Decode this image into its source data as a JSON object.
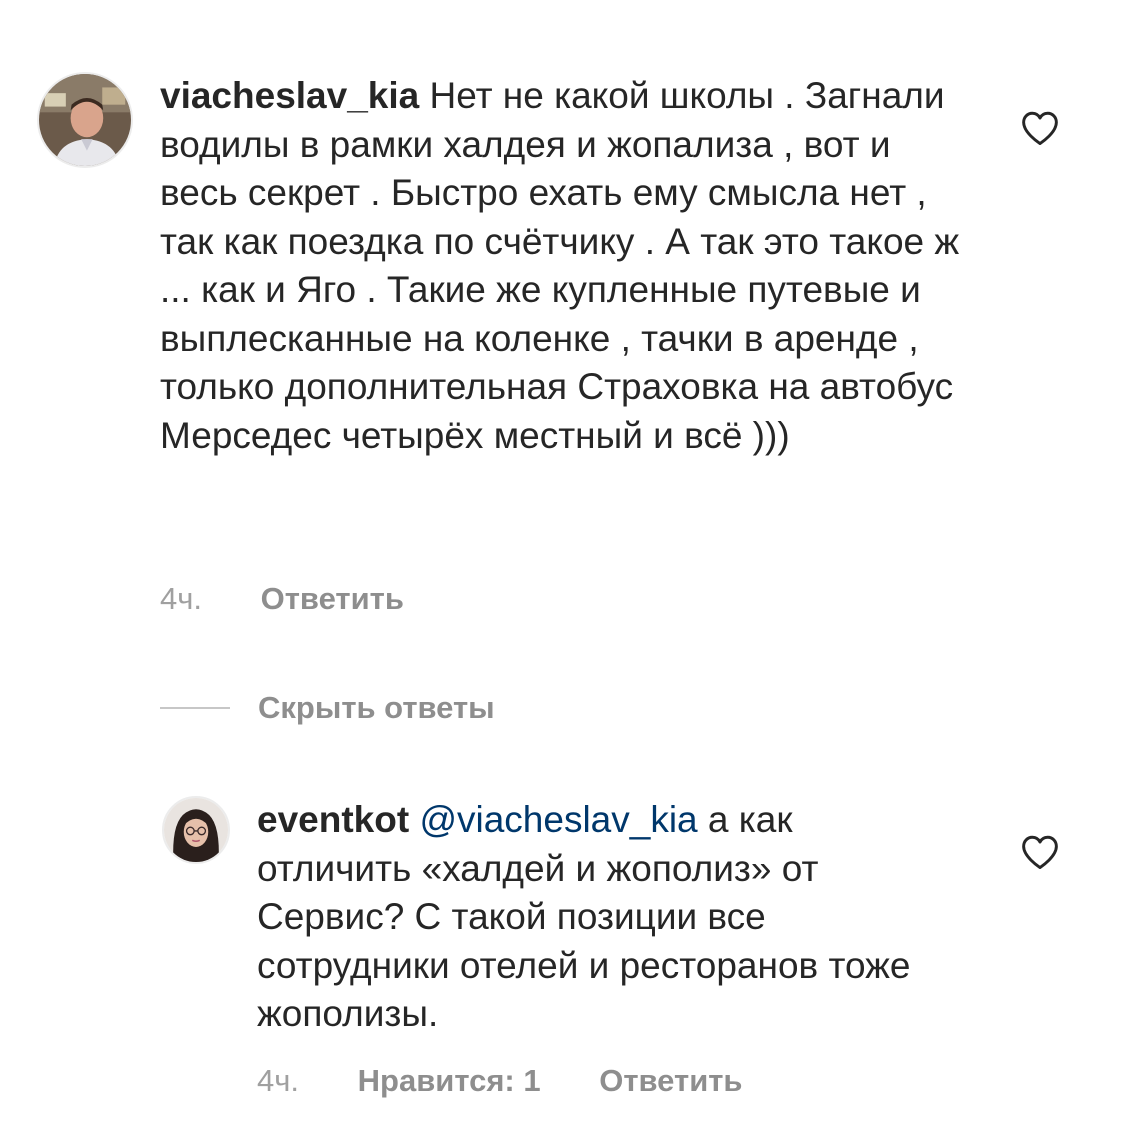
{
  "comments": [
    {
      "username": "viacheslav_kia",
      "text": "Нет не какой школы . Загнали водилы в рамки халдея и жопализа , вот и весь секрет . Быстро ехать ему смысла нет , так как поездка по счётчику . А так это такое ж ... как и Яго . Такие же купленные путевые и выплесканные на коленке , тачки в аренде , только дополнительная Страховка на автобус Мерседес четырёх местный и всё )))",
      "time": "4ч.",
      "reply_label": "Ответить",
      "avatar_icon": "user-avatar-man"
    }
  ],
  "hide_replies_label": "Скрыть ответы",
  "replies": [
    {
      "username": "eventkot",
      "mention": "@viacheslav_kia",
      "text": " а как отличить «халдей и жополиз» от Сервис? С такой позиции все сотрудники отелей и ресторанов тоже жополизы.",
      "time": "4ч.",
      "likes_label": "Нравится: 1",
      "reply_label": "Ответить",
      "avatar_icon": "user-avatar-woman"
    }
  ],
  "icons": {
    "like": "heart-outline-icon"
  },
  "colors": {
    "text": "#262626",
    "secondary": "#8e8e8e",
    "mention": "#00376b",
    "divider": "#c7c7c7"
  }
}
